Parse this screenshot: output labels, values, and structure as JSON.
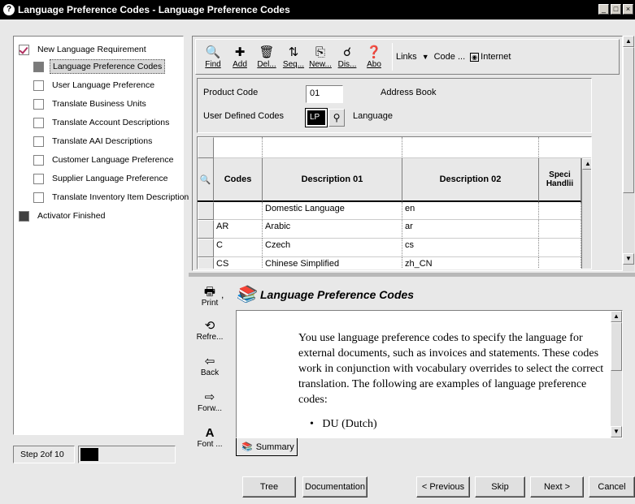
{
  "window": {
    "title": "Language Preference Codes - Language Preference Codes",
    "controls": [
      "_",
      "□",
      "×"
    ]
  },
  "tree": {
    "items": [
      {
        "label": "New Language Requirement",
        "state": "checked"
      },
      {
        "label": "Language Preference Codes",
        "state": "active",
        "selected": true
      },
      {
        "label": "User Language Preference",
        "state": "empty"
      },
      {
        "label": "Translate Business Units",
        "state": "empty"
      },
      {
        "label": "Translate Account Descriptions",
        "state": "empty"
      },
      {
        "label": "Translate AAI Descriptions",
        "state": "empty"
      },
      {
        "label": "Customer Language Preference",
        "state": "empty"
      },
      {
        "label": "Supplier Language Preference",
        "state": "empty"
      },
      {
        "label": "Translate Inventory Item Description",
        "state": "empty"
      },
      {
        "label": "Activator Finished",
        "state": "dark"
      }
    ]
  },
  "step": {
    "label": "Step 2of 10",
    "progress": 0.2
  },
  "toolbar": {
    "buttons": [
      {
        "label": "Find",
        "icon": "find-icon",
        "glyph": "🔍"
      },
      {
        "label": "Add",
        "icon": "add-icon",
        "glyph": "✚"
      },
      {
        "label": "Del...",
        "icon": "delete-icon",
        "glyph": "🗑"
      },
      {
        "label": "Seq...",
        "icon": "sequence-icon",
        "glyph": "⇅"
      },
      {
        "label": "New...",
        "icon": "new-icon",
        "glyph": "⎘"
      },
      {
        "label": "Dis...",
        "icon": "display-icon",
        "glyph": "☌"
      },
      {
        "label": "Abo",
        "icon": "about-icon",
        "glyph": "❓"
      }
    ],
    "links_label": "Links",
    "code_label": "Code ...",
    "internet_label": "Internet"
  },
  "header": {
    "product_code_label": "Product Code",
    "product_code_value": "01",
    "product_code_desc": "Address Book",
    "udc_label": "User Defined Codes",
    "udc_value": "LP",
    "udc_desc": "Language"
  },
  "grid": {
    "columns": [
      "Codes",
      "Description 01",
      "Description 02",
      "Speci Handlii"
    ],
    "rows": [
      {
        "code": "",
        "desc1": "Domestic Language",
        "desc2": "en"
      },
      {
        "code": "AR",
        "desc1": "Arabic",
        "desc2": "ar"
      },
      {
        "code": "C",
        "desc1": "Czech",
        "desc2": "cs"
      },
      {
        "code": "CS",
        "desc1": "Chinese Simplified",
        "desc2": "zh_CN"
      }
    ]
  },
  "doc": {
    "title": "Language Preference Codes",
    "tools": [
      {
        "label": "Print",
        "glyph": "🖶"
      },
      {
        "label": "Refre...",
        "glyph": "⟲"
      },
      {
        "label": "Back",
        "glyph": "⇦"
      },
      {
        "label": "Forw...",
        "glyph": "⇨"
      },
      {
        "label": "Font ...",
        "glyph": "A"
      }
    ],
    "text": "You use language preference codes to specify the language for external documents, such as invoices and statements. These codes work in conjunction with vocabulary overrides to select the correct translation. The following are examples of language preference codes:",
    "bullet": "DU (Dutch)",
    "tab_label": "Summary"
  },
  "buttons": {
    "tree": "Tree",
    "documentation": "Documentation",
    "previous": "< Previous",
    "skip": "Skip",
    "next": "Next >",
    "cancel": "Cancel"
  }
}
